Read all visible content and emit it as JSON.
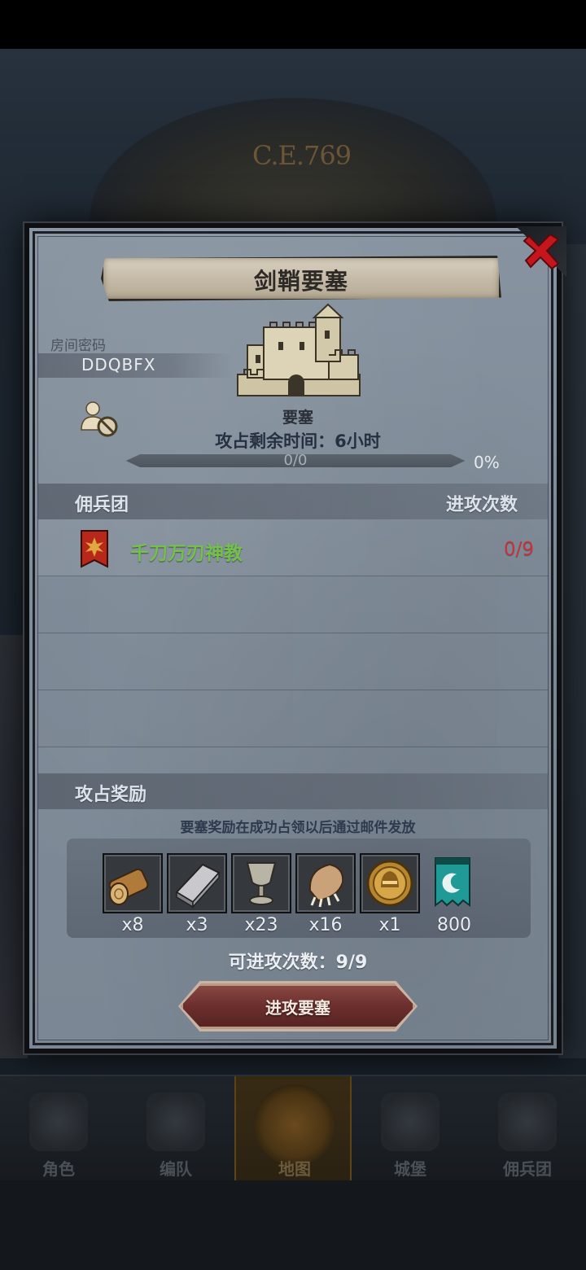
{
  "background": {
    "year": "C.E.769",
    "nav": [
      {
        "label": "角色",
        "icon": "character-icon"
      },
      {
        "label": "编队",
        "icon": "formation-icon"
      },
      {
        "label": "地图",
        "icon": "map-icon"
      },
      {
        "label": "城堡",
        "icon": "castle-icon"
      },
      {
        "label": "佣兵团",
        "icon": "mercenary-icon"
      }
    ],
    "active_nav": "地图"
  },
  "modal": {
    "title": "剑鞘要塞",
    "room_password_label": "房间密码",
    "room_password": "DDQBFX",
    "fortress_label": "要塞",
    "remaining_time": "攻占剩余时间：6小时",
    "progress": {
      "text": "0/0",
      "percent_text": "0%",
      "value": 0
    },
    "mercenary_header": "佣兵团",
    "attack_count_header": "进攻次数",
    "mercenaries": [
      {
        "name": "千刀万刃神教",
        "attacks": "0/9"
      }
    ],
    "rewards_header": "攻占奖励",
    "rewards_note": "要塞奖励在成功占领以后通过邮件发放",
    "rewards": [
      {
        "icon": "wood-log-icon",
        "count": "x8"
      },
      {
        "icon": "iron-ingot-icon",
        "count": "x3"
      },
      {
        "icon": "goblet-icon",
        "count": "x23"
      },
      {
        "icon": "beast-claw-icon",
        "count": "x16"
      },
      {
        "icon": "knight-medal-icon",
        "count": "x1"
      },
      {
        "icon": "guild-banner-icon",
        "count": "800"
      }
    ],
    "remaining_attacks": "可进攻次数：9/9",
    "attack_button": "进攻要塞"
  },
  "colors": {
    "mercenary_name": "#73c04b",
    "attack_count": "#c5333b",
    "panel": "#808c99",
    "button": "#6c2f2d"
  }
}
